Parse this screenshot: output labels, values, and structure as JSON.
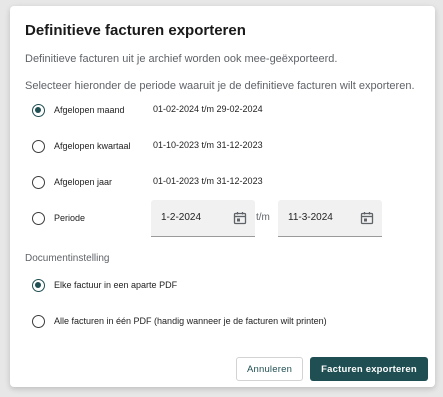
{
  "dialog": {
    "title": "Definitieve facturen exporteren",
    "intro": "Definitieve facturen uit je archief worden ook mee-geëxporteerd.",
    "instruction": "Selecteer hieronder de periode waaruit je de definitieve facturen wilt exporteren."
  },
  "periods": [
    {
      "label": "Afgelopen maand",
      "range": "01-02-2024 t/m 29-02-2024",
      "checked": true
    },
    {
      "label": "Afgelopen kwartaal",
      "range": "01-10-2023 t/m 31-12-2023",
      "checked": false
    },
    {
      "label": "Afgelopen jaar",
      "range": "01-01-2023 t/m 31-12-2023",
      "checked": false
    },
    {
      "label": "Periode",
      "checked": false
    }
  ],
  "custom_period": {
    "from": "1-2-2024",
    "separator": "t/m",
    "to": "11-3-2024"
  },
  "document_setting": {
    "heading": "Documentinstelling",
    "options": [
      {
        "label": "Elke factuur in een aparte PDF",
        "checked": true
      },
      {
        "label": "Alle facturen in één PDF (handig wanneer je de facturen wilt printen)",
        "checked": false
      }
    ]
  },
  "buttons": {
    "cancel": "Annuleren",
    "export": "Facturen exporteren"
  },
  "colors": {
    "accent": "#1f4f52",
    "muted_text": "#5f6368",
    "field_bg": "#f1f1f1"
  }
}
